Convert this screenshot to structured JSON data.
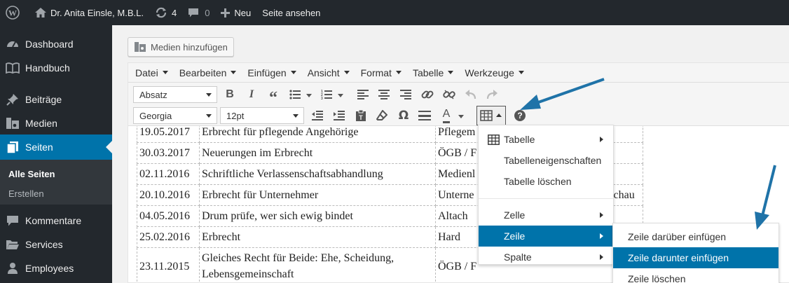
{
  "adminbar": {
    "site_name": "Dr. Anita Einsle, M.B.L.",
    "updates_count": "4",
    "comments_count": "0",
    "new_label": "Neu",
    "view_label": "Seite ansehen"
  },
  "sidebar": {
    "items": [
      {
        "label": "Dashboard",
        "icon": "dashboard-icon"
      },
      {
        "label": "Handbuch",
        "icon": "book-icon"
      },
      {
        "label": "Beiträge",
        "icon": "pin-icon"
      },
      {
        "label": "Medien",
        "icon": "media-icon"
      },
      {
        "label": "Seiten",
        "icon": "pages-icon"
      },
      {
        "label": "Kommentare",
        "icon": "comment-icon"
      },
      {
        "label": "Services",
        "icon": "folder-icon"
      },
      {
        "label": "Employees",
        "icon": "person-icon"
      }
    ],
    "submenu": [
      "Alle Seiten",
      "Erstellen"
    ]
  },
  "editor": {
    "media_button": "Medien hinzufügen",
    "menubar": [
      "Datei",
      "Bearbeiten",
      "Einfügen",
      "Ansicht",
      "Format",
      "Tabelle",
      "Werkzeuge"
    ],
    "format_select": "Absatz",
    "font_select": "Georgia",
    "size_select": "12pt",
    "color_letter": "A",
    "help_icon_text": "?"
  },
  "table_rows": [
    [
      "19.05.2017",
      "Erbrecht für pflegende Angehörige",
      "Pflegem"
    ],
    [
      "30.03.2017",
      "Neuerungen im Erbrecht",
      "ÖGB / F"
    ],
    [
      "02.11.2016",
      "Schriftliche Verlassenschaftsabhandlung",
      "Medienl"
    ],
    [
      "20.10.2016",
      "Erbrecht für Unternehmer",
      "Unterne"
    ],
    [
      "04.05.2016",
      "Drum prüfe, wer sich ewig bindet",
      "Altach"
    ],
    [
      "25.02.2016",
      "Erbrecht",
      "Hard"
    ],
    [
      "23.11.2015",
      "Gleiches Recht für Beide: Ehe, Scheidung, Lebensgemeinschaft",
      "ÖGB / F"
    ]
  ],
  "table_overflow_text": "chau",
  "table_menu": {
    "items": [
      "Tabelle",
      "Tabelleneigenschaften",
      "Tabelle löschen",
      "Zelle",
      "Zeile",
      "Spalte"
    ],
    "highlighted": "Zeile"
  },
  "row_submenu": {
    "items": [
      "Zeile darüber einfügen",
      "Zeile darunter einfügen",
      "Zeile löschen"
    ],
    "highlighted": "Zeile darunter einfügen"
  },
  "colors": {
    "admin_dark": "#23282d",
    "accent_blue": "#0073aa",
    "annotation_arrow": "#1f73a8"
  }
}
